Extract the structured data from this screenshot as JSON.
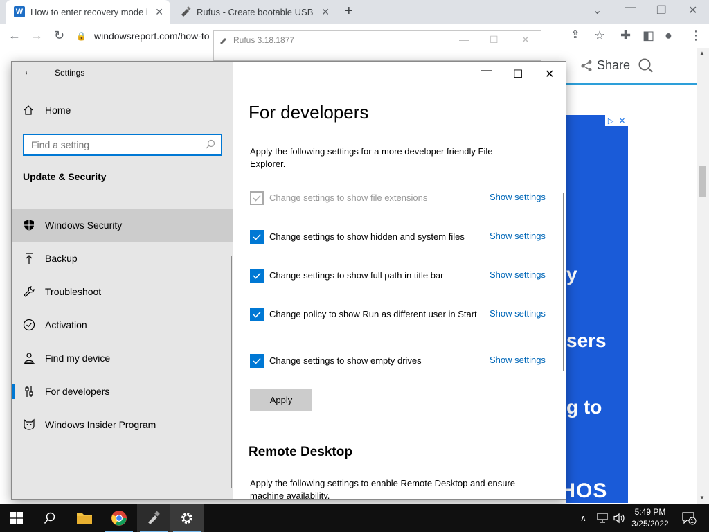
{
  "browser": {
    "tabs": [
      {
        "title": "How to enter recovery mode in W",
        "favicon": "W",
        "active": true
      },
      {
        "title": "Rufus - Create bootable USB driv",
        "active": false
      }
    ],
    "new_tab": "+",
    "url": "windowsreport.com/how-to",
    "webpage": {
      "share_label": "Share",
      "ad_lines": [
        "y",
        "sers",
        "g to"
      ],
      "ad_brand": "SOPHOS",
      "accent_color": "#2d9fd9",
      "ad_color": "#1a5bd8"
    }
  },
  "rufus": {
    "title": "Rufus 3.18.1877"
  },
  "settings": {
    "app_title": "Settings",
    "home_label": "Home",
    "search_placeholder": "Find a setting",
    "section_title": "Update & Security",
    "nav_items": [
      {
        "label": "Windows Security",
        "icon": "shield-icon"
      },
      {
        "label": "Backup",
        "icon": "backup-arrow-icon"
      },
      {
        "label": "Troubleshoot",
        "icon": "wrench-icon"
      },
      {
        "label": "Activation",
        "icon": "check-circle-icon"
      },
      {
        "label": "Find my device",
        "icon": "person-location-icon"
      },
      {
        "label": "For developers",
        "icon": "developer-sliders-icon"
      },
      {
        "label": "Windows Insider Program",
        "icon": "insider-cat-icon"
      }
    ],
    "page_title": "For developers",
    "description": "Apply the following settings for a more developer friendly File Explorer.",
    "options": [
      {
        "label": "Change settings to show file extensions",
        "checked": true,
        "disabled": true,
        "link": "Show settings"
      },
      {
        "label": "Change settings to show hidden and system files",
        "checked": true,
        "disabled": false,
        "link": "Show settings"
      },
      {
        "label": "Change settings to show full path in title bar",
        "checked": true,
        "disabled": false,
        "link": "Show settings"
      },
      {
        "label": "Change policy to show Run as different user in Start",
        "checked": true,
        "disabled": false,
        "link": "Show settings"
      },
      {
        "label": "Change settings to show empty drives",
        "checked": true,
        "disabled": false,
        "link": "Show settings"
      }
    ],
    "apply_label": "Apply",
    "remote_title": "Remote Desktop",
    "remote_description": "Apply the following settings to enable Remote Desktop and ensure machine availability.",
    "accent_color": "#0078d4",
    "link_color": "#0067b8"
  },
  "taskbar": {
    "time": "5:49 PM",
    "date": "3/25/2022",
    "notification_count": "1"
  }
}
